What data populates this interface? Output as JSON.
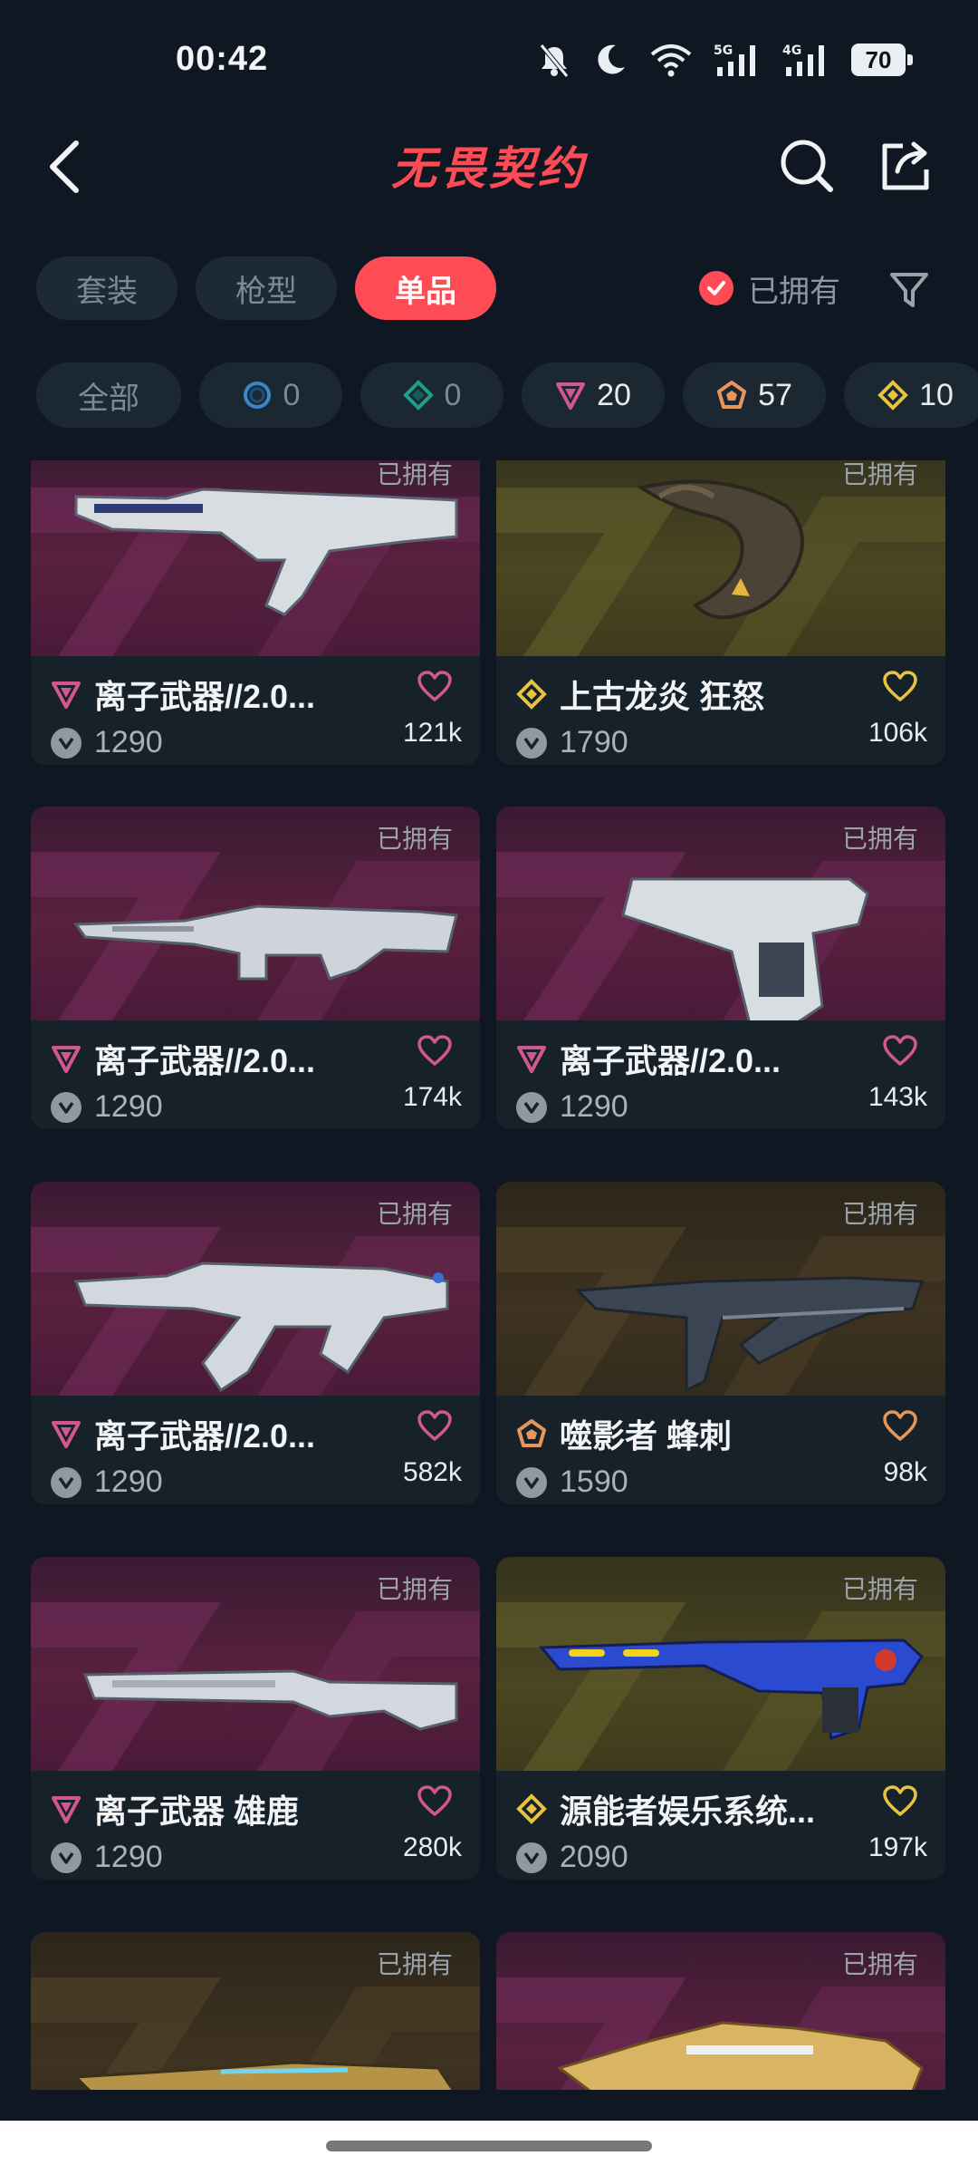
{
  "status_bar": {
    "time": "00:42",
    "battery": "70",
    "net1": "5G",
    "net2": "4G"
  },
  "header": {
    "title": "无畏契约"
  },
  "tabs": [
    {
      "label": "套装",
      "active": false
    },
    {
      "label": "枪型",
      "active": false
    },
    {
      "label": "单品",
      "active": true
    }
  ],
  "owned_filter": {
    "label": "已拥有",
    "checked": true
  },
  "chips": [
    {
      "label": "全部",
      "icon": "none"
    },
    {
      "label": "0",
      "icon": "select-tier-icon",
      "color": "#3b86c9"
    },
    {
      "label": "0",
      "icon": "deluxe-tier-icon",
      "color": "#1f9e8e"
    },
    {
      "label": "20",
      "icon": "premium-tier-icon",
      "color": "#d3578f"
    },
    {
      "label": "57",
      "icon": "exclusive-tier-icon",
      "color": "#e8955a"
    },
    {
      "label": "10",
      "icon": "ultra-tier-icon",
      "color": "#e8c341"
    }
  ],
  "owned_tag": "已拥有",
  "cards": [
    {
      "name": "离子武器//2.0...",
      "price": "1290",
      "likes": "121k",
      "tier": "premium",
      "theme": "purple",
      "weapon": "smg"
    },
    {
      "name": "上古龙炎 狂怒",
      "price": "1790",
      "likes": "106k",
      "tier": "ultra",
      "theme": "gold",
      "weapon": "dragon"
    },
    {
      "name": "离子武器//2.0...",
      "price": "1290",
      "likes": "174k",
      "tier": "premium",
      "theme": "purple",
      "weapon": "rifle"
    },
    {
      "name": "离子武器//2.0...",
      "price": "1290",
      "likes": "143k",
      "tier": "premium",
      "theme": "purple",
      "weapon": "pistol"
    },
    {
      "name": "离子武器//2.0...",
      "price": "1290",
      "likes": "582k",
      "tier": "premium",
      "theme": "purple",
      "weapon": "vandal"
    },
    {
      "name": "噬影者 蜂刺",
      "price": "1590",
      "likes": "98k",
      "tier": "exclusive",
      "theme": "bronze",
      "weapon": "spectre"
    },
    {
      "name": "离子武器 雄鹿",
      "price": "1290",
      "likes": "280k",
      "tier": "premium",
      "theme": "purple",
      "weapon": "shotgun"
    },
    {
      "name": "源能者娱乐系统...",
      "price": "2090",
      "likes": "197k",
      "tier": "ultra",
      "theme": "gold",
      "weapon": "blaster"
    },
    {
      "name": "",
      "price": "",
      "likes": "",
      "tier": "exclusive",
      "theme": "bronze",
      "weapon": "sniper"
    },
    {
      "name": "",
      "price": "",
      "likes": "",
      "tier": "premium",
      "theme": "purple",
      "weapon": "ornate"
    }
  ],
  "colors": {
    "accent": "#fd4c55",
    "premium": "#d3578f",
    "ultra": "#e8c341",
    "exclusive": "#e8955a"
  }
}
